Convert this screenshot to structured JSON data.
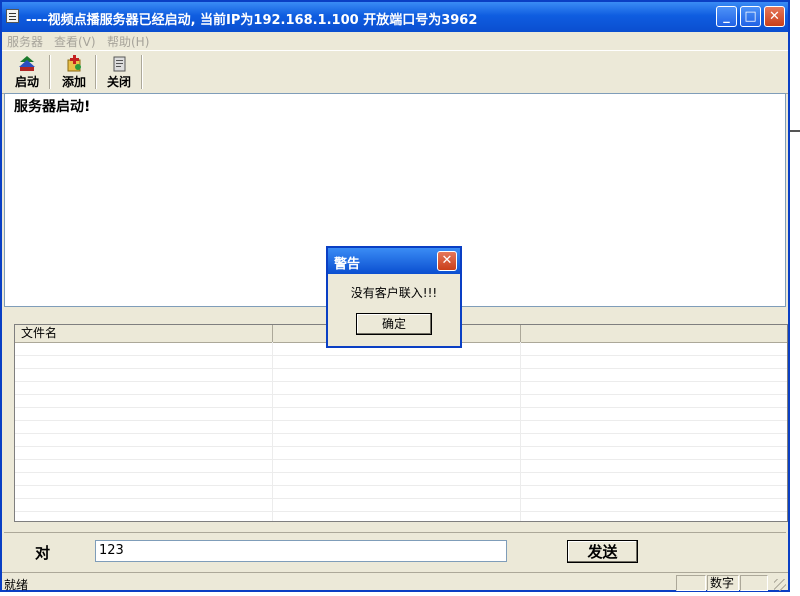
{
  "window": {
    "title": "----视频点播服务器已经启动, 当前IP为192.168.1.100  开放端口号为3962",
    "buttons": {
      "minimize": "_",
      "maximize": "□",
      "close": "✕"
    }
  },
  "menu": [
    {
      "label": "服务器"
    },
    {
      "label": "查看(V)"
    },
    {
      "label": "帮助(H)"
    }
  ],
  "toolbar": [
    {
      "label": "启动",
      "icon": "start-icon"
    },
    {
      "label": "添加",
      "icon": "add-icon"
    },
    {
      "label": "关闭",
      "icon": "close-icon"
    }
  ],
  "log": {
    "text": "服务器启动!"
  },
  "list": {
    "columns": [
      {
        "label": "文件名"
      },
      {
        "label": ""
      },
      {
        "label": ""
      }
    ]
  },
  "send": {
    "label": "对",
    "input_value": "123",
    "button_label": "发送"
  },
  "status": {
    "text": "就绪",
    "panes": [
      "",
      "数字",
      ""
    ]
  },
  "dialog": {
    "title": "警告",
    "message": "没有客户联入!!!",
    "ok_label": "确定",
    "close_glyph": "✕"
  },
  "colors": {
    "titlebar": "#0a4ed0",
    "window_face": "#ece9d8",
    "close_button": "#c93f1a"
  }
}
